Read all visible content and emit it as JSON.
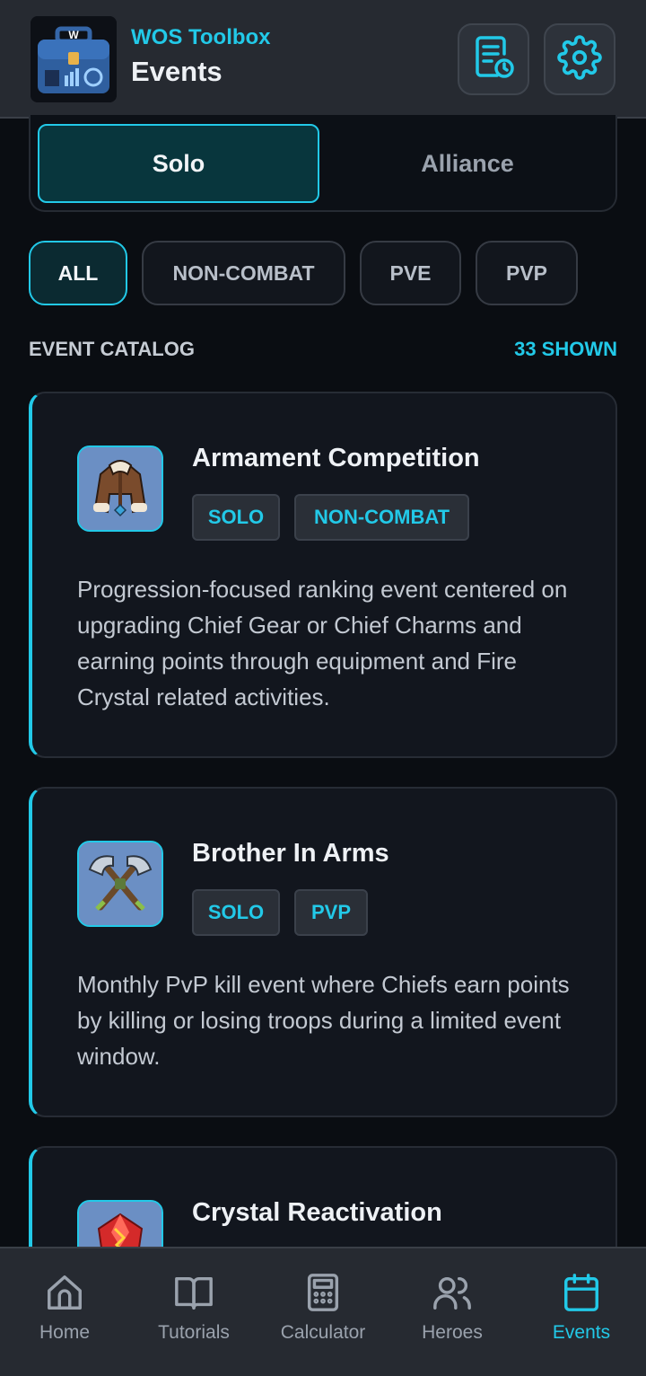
{
  "header": {
    "app_name": "WOS Toolbox",
    "title": "Events",
    "logo_icon": "toolbox-logo-icon",
    "buttons": [
      {
        "icon": "schedule-report-icon"
      },
      {
        "icon": "gear-icon"
      }
    ]
  },
  "segment": {
    "options": [
      "Solo",
      "Alliance"
    ],
    "selected": "Solo"
  },
  "filters": {
    "chips": [
      "ALL",
      "NON-COMBAT",
      "PVE",
      "PVP"
    ],
    "selected": "ALL"
  },
  "catalog": {
    "label": "EVENT CATALOG",
    "count": "33 SHOWN"
  },
  "events": [
    {
      "title": "Armament Competition",
      "tags": [
        "SOLO",
        "NON-COMBAT"
      ],
      "description": "Progression-focused ranking event centered on upgrading Chief Gear or Chief Charms and earning points through equipment and Fire Crystal related activities.",
      "icon": "fur-coat-icon"
    },
    {
      "title": "Brother In Arms",
      "tags": [
        "SOLO",
        "PVP"
      ],
      "description": "Monthly PvP kill event where Chiefs earn points by killing or losing troops during a limited event window.",
      "icon": "crossed-axes-icon"
    },
    {
      "title": "Crystal Reactivation",
      "tags": [],
      "description": "",
      "icon": "red-crystal-icon"
    }
  ],
  "nav": {
    "items": [
      "Home",
      "Tutorials",
      "Calculator",
      "Heroes",
      "Events"
    ],
    "active": "Events"
  },
  "colors": {
    "accent": "#22c9e8",
    "background": "#0a0d12",
    "card": "#12161e",
    "header": "#262a31"
  }
}
